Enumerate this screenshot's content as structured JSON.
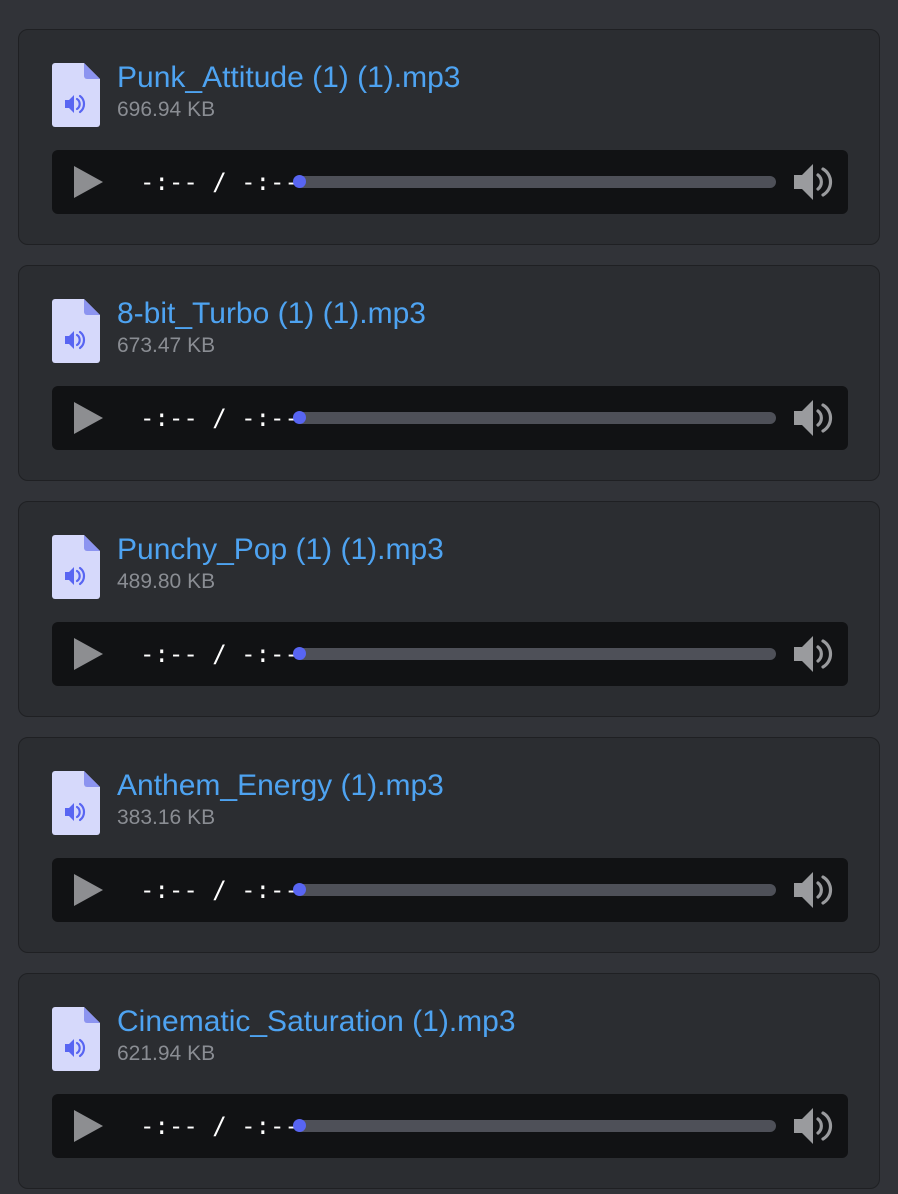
{
  "colors": {
    "background": "#313338",
    "card": "#2b2d31",
    "player": "#111214",
    "link": "#4ea3f1",
    "meta": "#8a8d93",
    "progress_thumb": "#5865f2",
    "track": "#4e5058"
  },
  "icons": {
    "file": "audio-file-icon",
    "play": "play-icon",
    "volume": "volume-icon"
  },
  "attachments": [
    {
      "name": "Punk_Attitude (1) (1).mp3",
      "size": "696.94 KB",
      "time": "-:-- / -:--",
      "progress": 0
    },
    {
      "name": "8-bit_Turbo (1) (1).mp3",
      "size": "673.47 KB",
      "time": "-:-- / -:--",
      "progress": 0
    },
    {
      "name": "Punchy_Pop (1) (1).mp3",
      "size": "489.80 KB",
      "time": "-:-- / -:--",
      "progress": 0
    },
    {
      "name": "Anthem_Energy (1).mp3",
      "size": "383.16 KB",
      "time": "-:-- / -:--",
      "progress": 0
    },
    {
      "name": "Cinematic_Saturation (1).mp3",
      "size": "621.94 KB",
      "time": "-:-- / -:--",
      "progress": 0
    }
  ]
}
